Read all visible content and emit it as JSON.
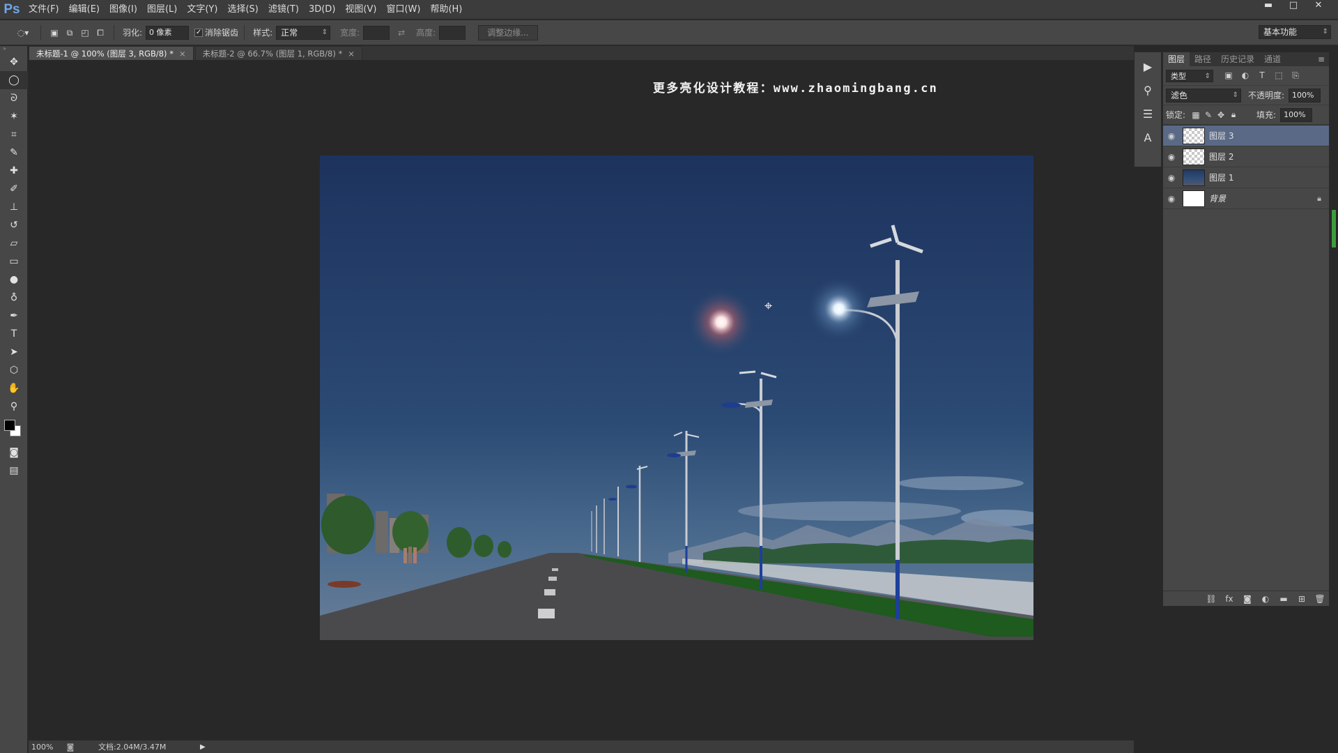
{
  "menu": {
    "logo": "Ps",
    "items": [
      "文件(F)",
      "编辑(E)",
      "图像(I)",
      "图层(L)",
      "文字(Y)",
      "选择(S)",
      "滤镜(T)",
      "3D(D)",
      "视图(V)",
      "窗口(W)",
      "帮助(H)"
    ]
  },
  "window_controls": {
    "minimize": "▬",
    "maximize": "□",
    "close": "✕"
  },
  "options": {
    "feather_label": "羽化:",
    "feather_value": "0 像素",
    "antialias_label": "消除锯齿",
    "antialias_checked": "✓",
    "style_label": "样式:",
    "style_value": "正常",
    "width_label": "宽度:",
    "height_label": "高度:",
    "refine_edge": "调整边缘...",
    "workspace": "基本功能"
  },
  "tabs": [
    {
      "label": "未标题-1 @ 100% (图层 3, RGB/8) *",
      "close": "×"
    },
    {
      "label": "未标题-2 @ 66.7% (图层 1, RGB/8) *",
      "close": "×"
    }
  ],
  "watermark": "更多亮化设计教程：www.zhaomingbang.cn",
  "status": {
    "zoom": "100%",
    "doc": "文档:2.04M/3.47M"
  },
  "layers_panel": {
    "tabs": [
      "图层",
      "路径",
      "历史记录",
      "通道"
    ],
    "filter_kind": "类型",
    "blend_mode": "滤色",
    "opacity_label": "不透明度:",
    "opacity_value": "100%",
    "lock_label": "锁定:",
    "fill_label": "填充:",
    "fill_value": "100%",
    "layers": [
      {
        "name": "图层 3",
        "selected": true
      },
      {
        "name": "图层 2",
        "selected": false
      },
      {
        "name": "图层 1",
        "selected": false
      },
      {
        "name": "背景",
        "selected": false
      }
    ]
  },
  "colors": {
    "accent": "#5a6a86",
    "panel_bg": "#474747",
    "canvas_bg": "#282828",
    "sky_top": "#1e3461",
    "sky_bottom": "#3f5f86"
  }
}
